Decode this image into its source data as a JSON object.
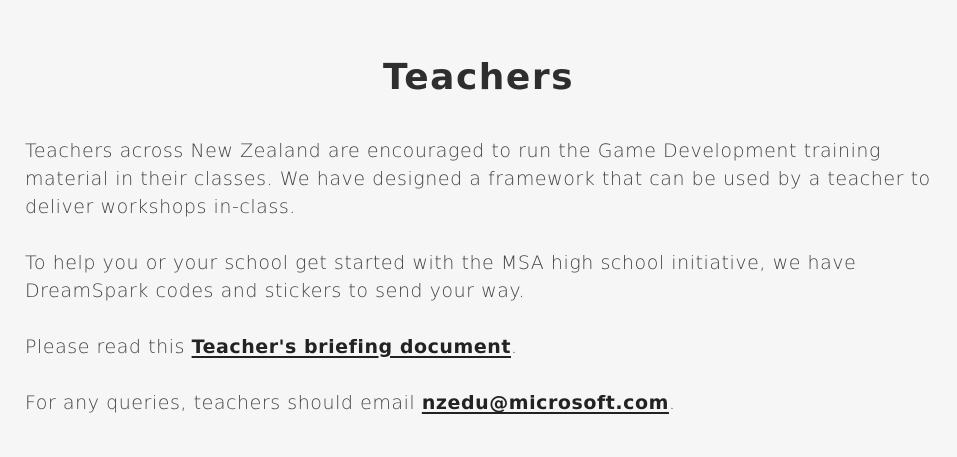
{
  "heading": "Teachers",
  "paragraphs": {
    "intro": "Teachers across New Zealand are encouraged to run the Game Development training material in their classes. We have designed a framework that can be used by a teacher to deliver workshops in-class.",
    "help": "To help you or your school get started with the MSA high school initiative, we have DreamSpark codes and stickers to send your way.",
    "briefing_prefix": "Please read this ",
    "briefing_link": "Teacher's briefing document",
    "briefing_suffix": ".",
    "queries_prefix": "For any queries, teachers should email ",
    "queries_link": "nzedu@microsoft.com",
    "queries_suffix": "."
  },
  "colors": {
    "background": "#f6f6f6",
    "text": "#444444",
    "heading": "#2e2e2e",
    "link": "#222222"
  }
}
